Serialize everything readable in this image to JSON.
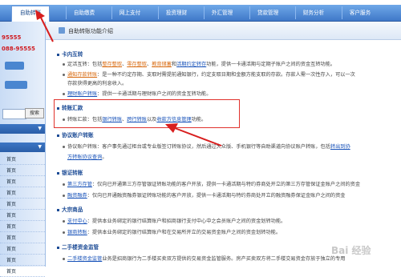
{
  "nav": {
    "tabs": [
      "自助转账",
      "自助缴费",
      "网上支付",
      "投资理财",
      "外汇管理",
      "贷款管理",
      "财务分析",
      "客户服务"
    ]
  },
  "sidebar": {
    "phone_1": "95555",
    "phone_2": "088-95555",
    "search_button": "搜索",
    "items": [
      "首页",
      "首页",
      "首页",
      "首页",
      "首页",
      "首页",
      "首页",
      "首页",
      "首页",
      "首页",
      "首页"
    ]
  },
  "breadcrumb": "自助转账功能介绍",
  "sections": {
    "s1": {
      "title": "卡内互转",
      "l1_a": "定活互转：包括",
      "l1_b": "整存整取",
      "l1_c": "、",
      "l1_d": "零存整取",
      "l1_e": "、",
      "l1_f": "教育储蓄",
      "l1_g": "和",
      "l1_h": "活期约定转存",
      "l1_i": "功能，提供一卡通活期与定期子账户之间的资金互转功能。",
      "l2_a": "通知存款转账",
      "l2_b": "：是一种不约定存期、支取时需提前通知银行，约定支取日期和金额方能支取的存款。存款人需一次性存入，可以一次",
      "l2_c": "存款获得更高的利息收入。",
      "l3_a": "理财账户转账",
      "l3_b": "：提供一卡通活期与理财账户之间的资金互转功能。"
    },
    "s2": {
      "title": "转账汇款",
      "l1_a": "转账汇款：包括",
      "l1_b": "银行转账",
      "l1_c": "、",
      "l1_d": "跨行转账",
      "l1_e": "以及",
      "l1_f": "收款方信息管理",
      "l1_g": "功能。"
    },
    "s3": {
      "title": "协议账户转账",
      "l1_a": "协议账户转账：客户事先通过柜台或专业版签订转账协议，然后通过大众版、手机银行等自助渠道向协议账户转账，包括",
      "l1_b": "转出到协",
      "l2": "方转账协议查询",
      "l2_b": "。"
    },
    "s4": {
      "title": "银证转账",
      "l1_a": "第三方存管",
      "l1_b": "：仅向已开通第三方存管银证转账功能的客户开放，提供一卡通活期与特约券商处开立的第三方存管保证金账户之间的资金",
      "l2_a": "融资融券",
      "l2_b": "：仅向已开通融资融券银证转账功能的客户开放，提供一卡通活期与特约券商处开立的融资融券保证金账户之间的资金"
    },
    "s5": {
      "title": "大宗商品",
      "l1_a": "支付中心",
      "l1_b": "：提供本业务绑定的银行结算账户和招商银行支付中心中之会员账户之间的资金划转功能。",
      "l2_a": "银商转账",
      "l2_b": "：提供本业务绑定的银行结算账户和在交易所开立的交易资金账户之间的资金划转功能。"
    },
    "s6": {
      "title": "二手楼资金监管",
      "l1_a": "二手楼资金监管",
      "l1_b": "业务是招商银行为二手楼买卖双方提供的交易资金监管服务。房产买卖双方将二手楼交易资金存放于独立的专用"
    }
  },
  "watermark": "Bai 经验"
}
